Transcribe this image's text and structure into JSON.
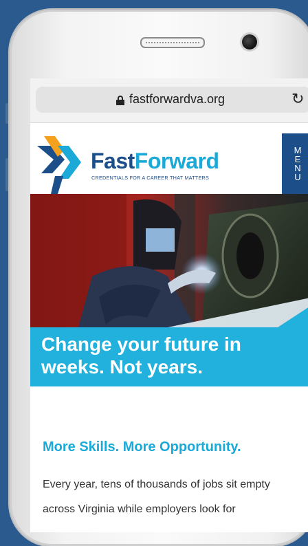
{
  "browser": {
    "url": "fastforwardva.org"
  },
  "site": {
    "brand_fast": "Fast",
    "brand_forward": "Forward",
    "tagline": "CREDENTIALS FOR A CAREER THAT MATTERS",
    "menu_letters": [
      "M",
      "E",
      "N",
      "U"
    ]
  },
  "hero": {
    "headline": "Change your future in weeks. Not years."
  },
  "content": {
    "subhead": "More Skills. More Opportunity.",
    "body_line_1": "Every year, tens of thousands of jobs sit empty",
    "body_line_2": "across Virginia while employers look for"
  },
  "colors": {
    "navy": "#1c4f8a",
    "cyan": "#1ba9d8",
    "background": "#2b5a8e"
  }
}
